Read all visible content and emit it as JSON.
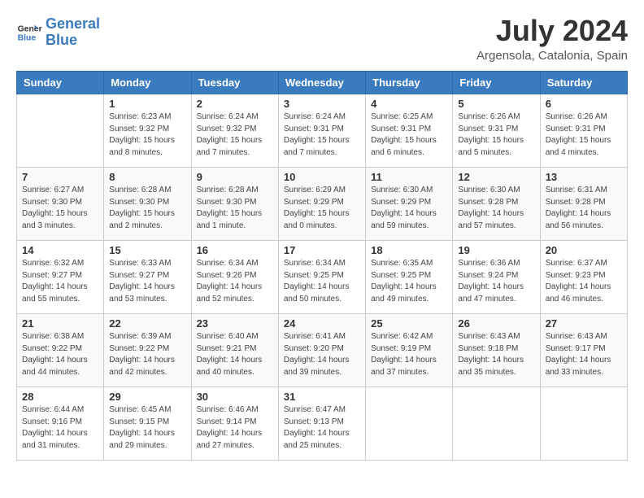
{
  "logo": {
    "line1": "General",
    "line2": "Blue"
  },
  "title": "July 2024",
  "location": "Argensola, Catalonia, Spain",
  "weekdays": [
    "Sunday",
    "Monday",
    "Tuesday",
    "Wednesday",
    "Thursday",
    "Friday",
    "Saturday"
  ],
  "weeks": [
    [
      {
        "day": "",
        "sunrise": "",
        "sunset": "",
        "daylight": ""
      },
      {
        "day": "1",
        "sunrise": "Sunrise: 6:23 AM",
        "sunset": "Sunset: 9:32 PM",
        "daylight": "Daylight: 15 hours and 8 minutes."
      },
      {
        "day": "2",
        "sunrise": "Sunrise: 6:24 AM",
        "sunset": "Sunset: 9:32 PM",
        "daylight": "Daylight: 15 hours and 7 minutes."
      },
      {
        "day": "3",
        "sunrise": "Sunrise: 6:24 AM",
        "sunset": "Sunset: 9:31 PM",
        "daylight": "Daylight: 15 hours and 7 minutes."
      },
      {
        "day": "4",
        "sunrise": "Sunrise: 6:25 AM",
        "sunset": "Sunset: 9:31 PM",
        "daylight": "Daylight: 15 hours and 6 minutes."
      },
      {
        "day": "5",
        "sunrise": "Sunrise: 6:26 AM",
        "sunset": "Sunset: 9:31 PM",
        "daylight": "Daylight: 15 hours and 5 minutes."
      },
      {
        "day": "6",
        "sunrise": "Sunrise: 6:26 AM",
        "sunset": "Sunset: 9:31 PM",
        "daylight": "Daylight: 15 hours and 4 minutes."
      }
    ],
    [
      {
        "day": "7",
        "sunrise": "Sunrise: 6:27 AM",
        "sunset": "Sunset: 9:30 PM",
        "daylight": "Daylight: 15 hours and 3 minutes."
      },
      {
        "day": "8",
        "sunrise": "Sunrise: 6:28 AM",
        "sunset": "Sunset: 9:30 PM",
        "daylight": "Daylight: 15 hours and 2 minutes."
      },
      {
        "day": "9",
        "sunrise": "Sunrise: 6:28 AM",
        "sunset": "Sunset: 9:30 PM",
        "daylight": "Daylight: 15 hours and 1 minute."
      },
      {
        "day": "10",
        "sunrise": "Sunrise: 6:29 AM",
        "sunset": "Sunset: 9:29 PM",
        "daylight": "Daylight: 15 hours and 0 minutes."
      },
      {
        "day": "11",
        "sunrise": "Sunrise: 6:30 AM",
        "sunset": "Sunset: 9:29 PM",
        "daylight": "Daylight: 14 hours and 59 minutes."
      },
      {
        "day": "12",
        "sunrise": "Sunrise: 6:30 AM",
        "sunset": "Sunset: 9:28 PM",
        "daylight": "Daylight: 14 hours and 57 minutes."
      },
      {
        "day": "13",
        "sunrise": "Sunrise: 6:31 AM",
        "sunset": "Sunset: 9:28 PM",
        "daylight": "Daylight: 14 hours and 56 minutes."
      }
    ],
    [
      {
        "day": "14",
        "sunrise": "Sunrise: 6:32 AM",
        "sunset": "Sunset: 9:27 PM",
        "daylight": "Daylight: 14 hours and 55 minutes."
      },
      {
        "day": "15",
        "sunrise": "Sunrise: 6:33 AM",
        "sunset": "Sunset: 9:27 PM",
        "daylight": "Daylight: 14 hours and 53 minutes."
      },
      {
        "day": "16",
        "sunrise": "Sunrise: 6:34 AM",
        "sunset": "Sunset: 9:26 PM",
        "daylight": "Daylight: 14 hours and 52 minutes."
      },
      {
        "day": "17",
        "sunrise": "Sunrise: 6:34 AM",
        "sunset": "Sunset: 9:25 PM",
        "daylight": "Daylight: 14 hours and 50 minutes."
      },
      {
        "day": "18",
        "sunrise": "Sunrise: 6:35 AM",
        "sunset": "Sunset: 9:25 PM",
        "daylight": "Daylight: 14 hours and 49 minutes."
      },
      {
        "day": "19",
        "sunrise": "Sunrise: 6:36 AM",
        "sunset": "Sunset: 9:24 PM",
        "daylight": "Daylight: 14 hours and 47 minutes."
      },
      {
        "day": "20",
        "sunrise": "Sunrise: 6:37 AM",
        "sunset": "Sunset: 9:23 PM",
        "daylight": "Daylight: 14 hours and 46 minutes."
      }
    ],
    [
      {
        "day": "21",
        "sunrise": "Sunrise: 6:38 AM",
        "sunset": "Sunset: 9:22 PM",
        "daylight": "Daylight: 14 hours and 44 minutes."
      },
      {
        "day": "22",
        "sunrise": "Sunrise: 6:39 AM",
        "sunset": "Sunset: 9:22 PM",
        "daylight": "Daylight: 14 hours and 42 minutes."
      },
      {
        "day": "23",
        "sunrise": "Sunrise: 6:40 AM",
        "sunset": "Sunset: 9:21 PM",
        "daylight": "Daylight: 14 hours and 40 minutes."
      },
      {
        "day": "24",
        "sunrise": "Sunrise: 6:41 AM",
        "sunset": "Sunset: 9:20 PM",
        "daylight": "Daylight: 14 hours and 39 minutes."
      },
      {
        "day": "25",
        "sunrise": "Sunrise: 6:42 AM",
        "sunset": "Sunset: 9:19 PM",
        "daylight": "Daylight: 14 hours and 37 minutes."
      },
      {
        "day": "26",
        "sunrise": "Sunrise: 6:43 AM",
        "sunset": "Sunset: 9:18 PM",
        "daylight": "Daylight: 14 hours and 35 minutes."
      },
      {
        "day": "27",
        "sunrise": "Sunrise: 6:43 AM",
        "sunset": "Sunset: 9:17 PM",
        "daylight": "Daylight: 14 hours and 33 minutes."
      }
    ],
    [
      {
        "day": "28",
        "sunrise": "Sunrise: 6:44 AM",
        "sunset": "Sunset: 9:16 PM",
        "daylight": "Daylight: 14 hours and 31 minutes."
      },
      {
        "day": "29",
        "sunrise": "Sunrise: 6:45 AM",
        "sunset": "Sunset: 9:15 PM",
        "daylight": "Daylight: 14 hours and 29 minutes."
      },
      {
        "day": "30",
        "sunrise": "Sunrise: 6:46 AM",
        "sunset": "Sunset: 9:14 PM",
        "daylight": "Daylight: 14 hours and 27 minutes."
      },
      {
        "day": "31",
        "sunrise": "Sunrise: 6:47 AM",
        "sunset": "Sunset: 9:13 PM",
        "daylight": "Daylight: 14 hours and 25 minutes."
      },
      {
        "day": "",
        "sunrise": "",
        "sunset": "",
        "daylight": ""
      },
      {
        "day": "",
        "sunrise": "",
        "sunset": "",
        "daylight": ""
      },
      {
        "day": "",
        "sunrise": "",
        "sunset": "",
        "daylight": ""
      }
    ]
  ]
}
